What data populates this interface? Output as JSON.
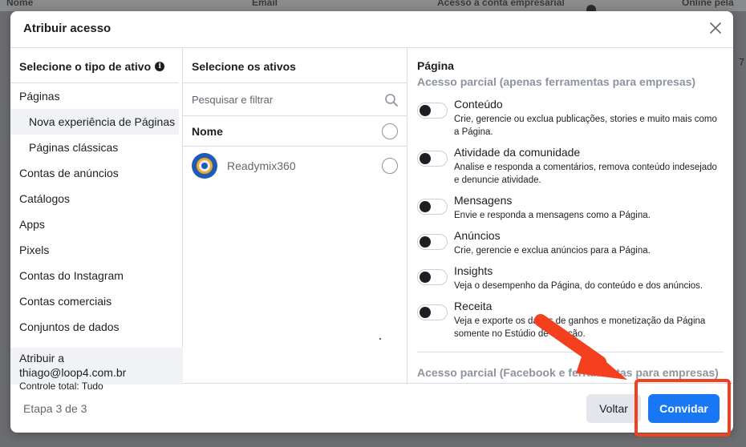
{
  "background": {
    "headers": [
      "Nome",
      "Email",
      "Acesso à conta empresarial",
      "Online pela"
    ],
    "side_number": "7"
  },
  "modal": {
    "title": "Atribuir acesso",
    "close_icon": "close-icon"
  },
  "asset_types": {
    "heading": "Selecione o tipo de ativo",
    "items": [
      {
        "label": "Páginas",
        "sub": false,
        "selected": false
      },
      {
        "label": "Nova experiência de Páginas",
        "sub": true,
        "selected": true
      },
      {
        "label": "Páginas clássicas",
        "sub": true,
        "selected": false
      },
      {
        "label": "Contas de anúncios",
        "sub": false,
        "selected": false
      },
      {
        "label": "Catálogos",
        "sub": false,
        "selected": false
      },
      {
        "label": "Apps",
        "sub": false,
        "selected": false
      },
      {
        "label": "Pixels",
        "sub": false,
        "selected": false
      },
      {
        "label": "Contas do Instagram",
        "sub": false,
        "selected": false
      },
      {
        "label": "Contas comerciais",
        "sub": false,
        "selected": false
      },
      {
        "label": "Conjuntos de dados",
        "sub": false,
        "selected": false
      }
    ],
    "assign": {
      "line1": "Atribuir a thiago@loop4.com.br",
      "line2": "Controle total: Tudo"
    }
  },
  "assets": {
    "heading": "Selecione os ativos",
    "search_placeholder": "Pesquisar e filtrar",
    "name_header": "Nome",
    "items": [
      {
        "name": "Readymix360",
        "selected": false
      }
    ]
  },
  "permissions": {
    "section_title": "Página",
    "section_subtitle": "Acesso parcial (apenas ferramentas para empresas)",
    "items": [
      {
        "title": "Conteúdo",
        "desc": "Crie, gerencie ou exclua publicações, stories e muito mais como a Página.",
        "enabled": false
      },
      {
        "title": "Atividade da comunidade",
        "desc": "Analise e responda a comentários, remova conteúdo indesejado e denuncie atividade.",
        "enabled": false
      },
      {
        "title": "Mensagens",
        "desc": "Envie e responda a mensagens como a Página.",
        "enabled": false
      },
      {
        "title": "Anúncios",
        "desc": "Crie, gerencie e exclua anúncios para a Página.",
        "enabled": false
      },
      {
        "title": "Insights",
        "desc": "Veja o desempenho da Página, do conteúdo e dos anúncios.",
        "enabled": false
      },
      {
        "title": "Receita",
        "desc": "Veja e exporte os dados de ganhos e monetização da Página somente no Estúdio de Criação.",
        "enabled": false
      }
    ],
    "section2_subtitle": "Acesso parcial (Facebook e ferramentas para empresas)"
  },
  "footer": {
    "step": "Etapa 3 de 3",
    "back_label": "Voltar",
    "invite_label": "Convidar"
  },
  "colors": {
    "primary": "#1877f2",
    "annotation": "#f4401f"
  }
}
